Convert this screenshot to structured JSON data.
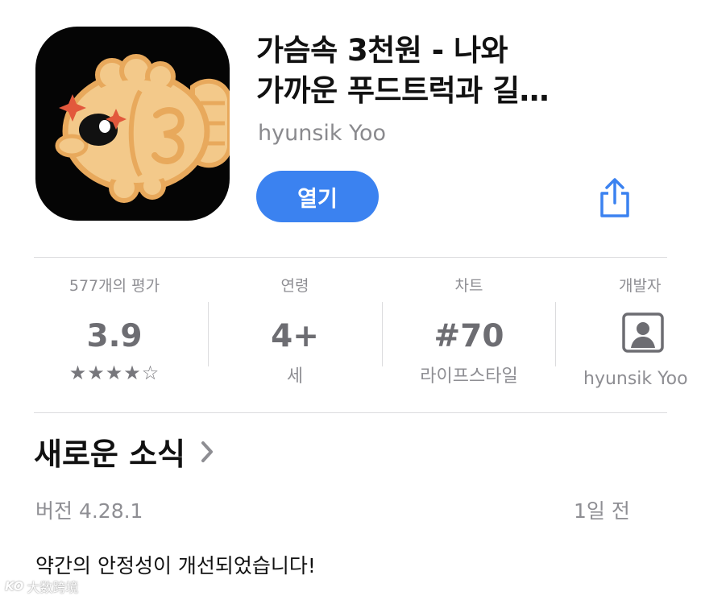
{
  "app": {
    "title_line1": "가슴속 3천원 - 나와",
    "title_line2": "가까운 푸드트럭과 길…",
    "developer": "hyunsik Yoo",
    "open_label": "열기"
  },
  "icons": {
    "app_icon": "taiyaki-fish-icon",
    "share": "share-icon",
    "developer": "person-icon",
    "chevron": "chevron-right-icon"
  },
  "stats": {
    "ratings": {
      "label": "577개의 평가",
      "value": "3.9",
      "stars": "★★★★☆",
      "rating": 3.9
    },
    "age": {
      "label": "연령",
      "value": "4+",
      "sub": "세"
    },
    "chart": {
      "label": "차트",
      "value": "#70",
      "sub": "라이프스타일"
    },
    "developer": {
      "label": "개발자",
      "sub": "hyunsik Yoo"
    }
  },
  "news": {
    "title": "새로운 소식",
    "version": "버전 4.28.1",
    "date": "1일 전",
    "notes": "약간의 안정성이 개선되었습니다!"
  },
  "watermark": {
    "logo": "KO",
    "text": "大数跨境"
  },
  "colors": {
    "accent": "#3b82f0",
    "icon_background": "#050505",
    "fish_fill": "#f3c98a",
    "fish_outline": "#e8a95c",
    "sparkle": "#e2583c"
  }
}
